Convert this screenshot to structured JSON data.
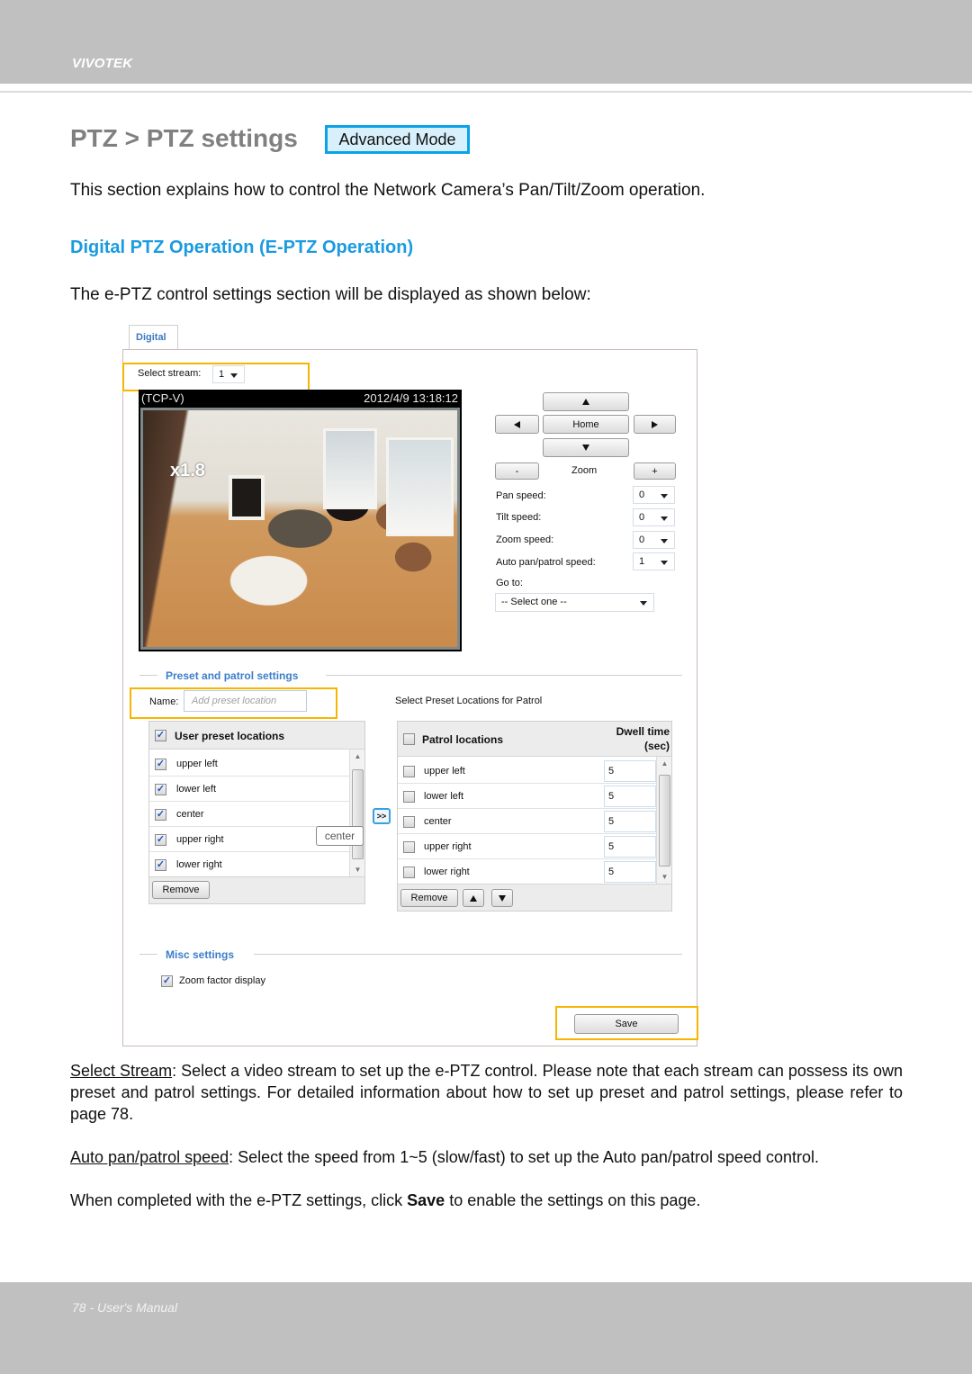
{
  "header": {
    "brand": "VIVOTEK"
  },
  "title": {
    "text": "PTZ > PTZ settings",
    "mode_badge": "Advanced Mode"
  },
  "intro": "This section explains how to control the Network Camera’s Pan/Tilt/Zoom operation.",
  "section_heading": "Digital PTZ Operation (E-PTZ Operation)",
  "lead": "The e-PTZ control settings section will be displayed as shown below:",
  "colors": {
    "accent_blue": "#1a9be0",
    "highlight": "#f7b500",
    "band_gray": "#bfc0bf"
  },
  "ui": {
    "tab": "Digital",
    "select_stream": {
      "label": "Select stream:",
      "value": "1"
    },
    "video": {
      "protocol": "(TCP-V)",
      "timestamp": "2012/4/9 13:18:12",
      "zoom_factor": "x1.8"
    },
    "ptz": {
      "home": "Home",
      "zoom_label": "Zoom",
      "zoom_out": "-",
      "zoom_in": "+",
      "up_icon": "arrow-up",
      "down_icon": "arrow-down",
      "left_icon": "arrow-left",
      "right_icon": "arrow-right"
    },
    "speeds": [
      {
        "label": "Pan speed:",
        "value": "0"
      },
      {
        "label": "Tilt speed:",
        "value": "0"
      },
      {
        "label": "Zoom speed:",
        "value": "0"
      },
      {
        "label": "Auto pan/patrol speed:",
        "value": "1"
      }
    ],
    "goto": {
      "label": "Go to:",
      "value": "-- Select one --"
    },
    "preset": {
      "legend": "Preset and patrol settings",
      "name_label": "Name:",
      "name_placeholder": "Add preset location",
      "user_header": "User preset locations",
      "user_items": [
        "upper left",
        "lower left",
        "center",
        "upper right",
        "lower right"
      ],
      "remove": "Remove",
      "add_button": ">>",
      "tooltip": "center",
      "patrol_title": "Select Preset Locations for Patrol",
      "patrol_header": "Patrol locations",
      "dwell_header_1": "Dwell time",
      "dwell_header_2": "(sec)",
      "patrol_items": [
        {
          "label": "upper left",
          "dwell": "5"
        },
        {
          "label": "lower left",
          "dwell": "5"
        },
        {
          "label": "center",
          "dwell": "5"
        },
        {
          "label": "upper right",
          "dwell": "5"
        },
        {
          "label": "lower right",
          "dwell": "5"
        }
      ],
      "patrol_remove": "Remove"
    },
    "misc": {
      "legend": "Misc settings",
      "zoom_factor_display": "Zoom factor display",
      "zoom_factor_checked": true
    },
    "save": "Save"
  },
  "descriptions": {
    "select_stream_term": "Select Stream",
    "select_stream_text": ": Select a video stream to set up the e-PTZ control. Please note that each stream can possess its own preset and patrol settings. For detailed information about how to set up preset and patrol settings, please refer to page 78.",
    "auto_speed_term": "Auto pan/patrol speed",
    "auto_speed_text": ": Select the speed from 1~5 (slow/fast) to set up the Auto pan/patrol speed control.",
    "save_pre": "When completed with the e-PTZ settings, click ",
    "save_bold": "Save",
    "save_post": " to enable the settings on this page."
  },
  "footer": {
    "text": "78 - User's Manual"
  }
}
